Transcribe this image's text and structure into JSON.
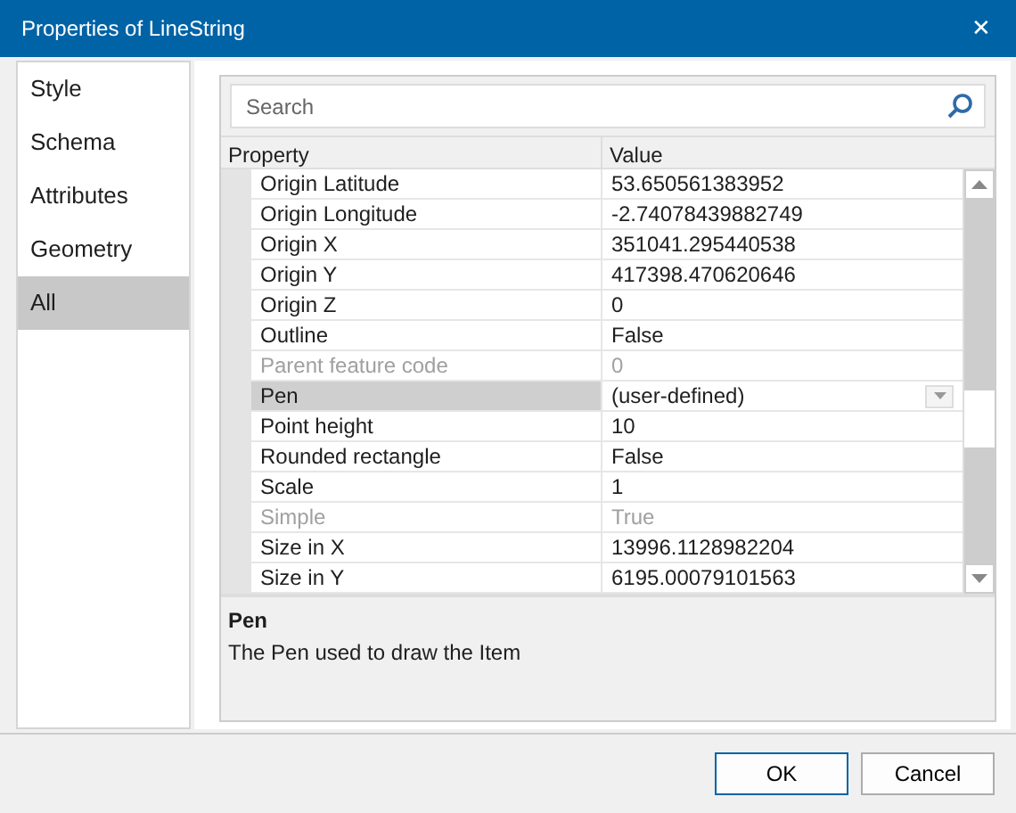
{
  "window": {
    "title": "Properties of LineString",
    "close": "✕"
  },
  "sidebar": {
    "items": [
      {
        "label": "Style",
        "selected": false
      },
      {
        "label": "Schema",
        "selected": false
      },
      {
        "label": "Attributes",
        "selected": false
      },
      {
        "label": "Geometry",
        "selected": false
      },
      {
        "label": "All",
        "selected": true
      }
    ]
  },
  "search": {
    "placeholder": "Search"
  },
  "grid": {
    "columns": [
      "Property",
      "Value"
    ],
    "rows": [
      {
        "name": "Origin Latitude",
        "value": "53.650561383952",
        "disabled": false,
        "selected": false,
        "kind": "text"
      },
      {
        "name": "Origin Longitude",
        "value": "-2.74078439882749",
        "disabled": false,
        "selected": false,
        "kind": "text"
      },
      {
        "name": "Origin X",
        "value": "351041.295440538",
        "disabled": false,
        "selected": false,
        "kind": "text"
      },
      {
        "name": "Origin Y",
        "value": "417398.470620646",
        "disabled": false,
        "selected": false,
        "kind": "text"
      },
      {
        "name": "Origin Z",
        "value": "0",
        "disabled": false,
        "selected": false,
        "kind": "text"
      },
      {
        "name": "Outline",
        "value": "False",
        "disabled": false,
        "selected": false,
        "kind": "text"
      },
      {
        "name": "Parent feature code",
        "value": "0",
        "disabled": true,
        "selected": false,
        "kind": "text"
      },
      {
        "name": "Pen",
        "value": "(user-defined)",
        "disabled": false,
        "selected": true,
        "kind": "dropdown"
      },
      {
        "name": "Point height",
        "value": "10",
        "disabled": false,
        "selected": false,
        "kind": "text"
      },
      {
        "name": "Rounded rectangle",
        "value": "False",
        "disabled": false,
        "selected": false,
        "kind": "text"
      },
      {
        "name": "Scale",
        "value": "1",
        "disabled": false,
        "selected": false,
        "kind": "text"
      },
      {
        "name": "Simple",
        "value": "True",
        "disabled": true,
        "selected": false,
        "kind": "text"
      },
      {
        "name": "Size in X",
        "value": "13996.1128982204",
        "disabled": false,
        "selected": false,
        "kind": "text"
      },
      {
        "name": "Size in Y",
        "value": "6195.00079101563",
        "disabled": false,
        "selected": false,
        "kind": "text"
      }
    ]
  },
  "description": {
    "title": "Pen",
    "text": "The Pen used to draw the Item"
  },
  "buttons": [
    "OK",
    "Cancel"
  ]
}
